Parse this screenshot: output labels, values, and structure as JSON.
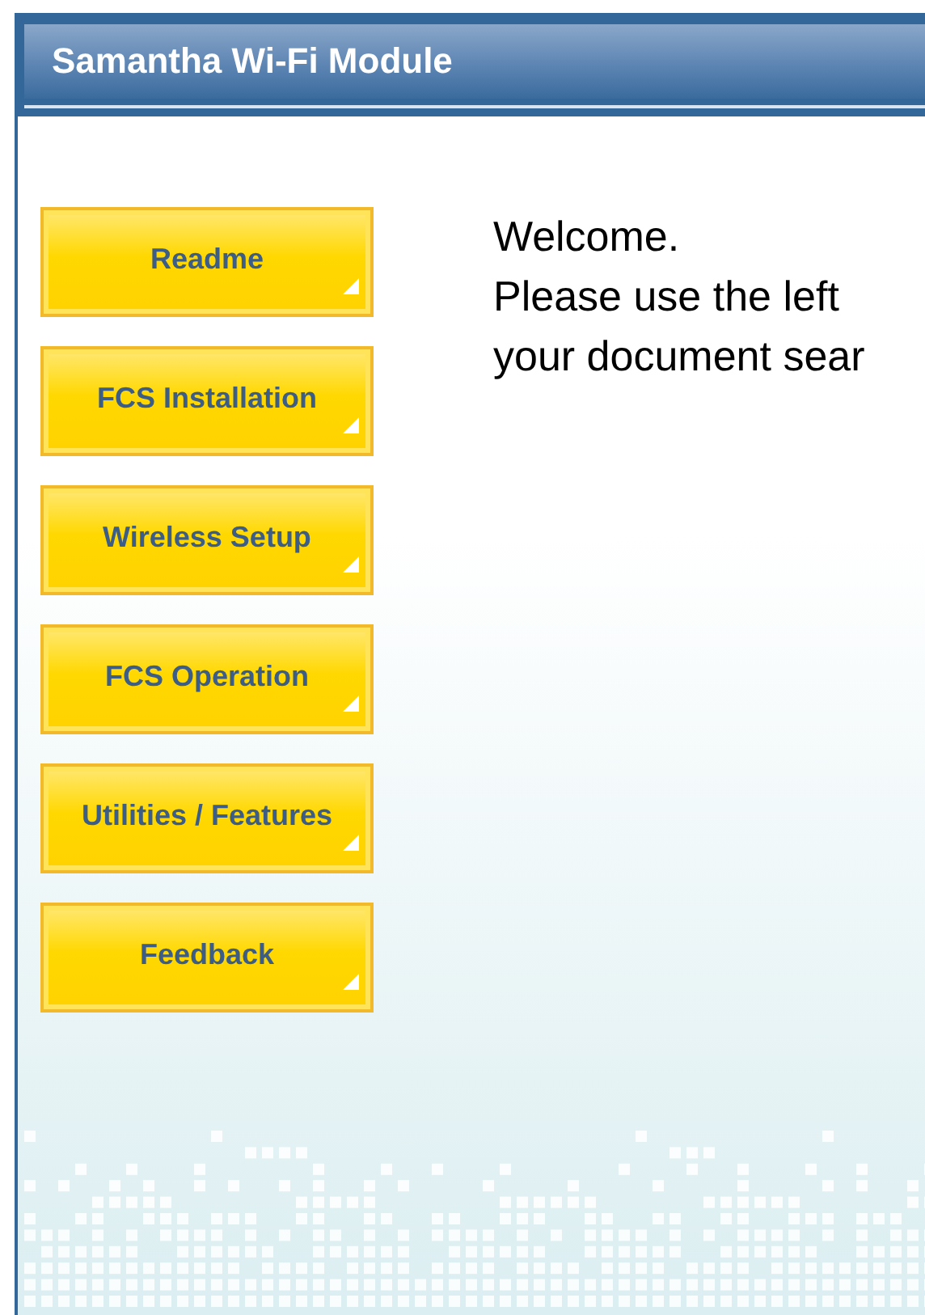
{
  "window": {
    "title": "Samantha Wi-Fi Module"
  },
  "nav_buttons": [
    {
      "label": "Readme"
    },
    {
      "label": "FCS Installation"
    },
    {
      "label": "Wireless Setup"
    },
    {
      "label": "FCS Operation"
    },
    {
      "label": "Utilities / Features"
    },
    {
      "label": "Feedback"
    }
  ],
  "welcome": {
    "lines": [
      "Welcome.",
      "Please use the left",
      "your document sear"
    ]
  }
}
